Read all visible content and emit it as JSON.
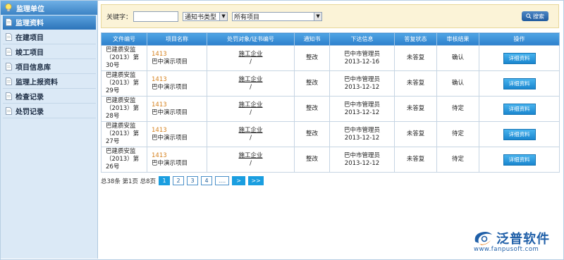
{
  "sidebar": {
    "title": "监理单位",
    "items": [
      {
        "label": "监理资料",
        "active": true
      },
      {
        "label": "在建项目",
        "active": false
      },
      {
        "label": "竣工项目",
        "active": false
      },
      {
        "label": "项目信息库",
        "active": false
      },
      {
        "label": "监理上报资料",
        "active": false
      },
      {
        "label": "检查记录",
        "active": false
      },
      {
        "label": "处罚记录",
        "active": false
      }
    ]
  },
  "search": {
    "keyword_label": "关键字：",
    "keyword_value": "",
    "type_select": "通知书类型",
    "project_select": "所有项目",
    "button_label": "搜索"
  },
  "table": {
    "headers": [
      "文件编号",
      "项目名称",
      "处罚对象/证书编号",
      "通知书",
      "下达信息",
      "答复状态",
      "审核结果",
      "操作"
    ],
    "rows": [
      {
        "doc_no": "巴建质安监（2013）第30号",
        "project_code": "1413",
        "project_name": "巴中演示项目",
        "target": "施工企业",
        "target_sub": "/",
        "notice": "整改",
        "issuer": "巴中市管理员",
        "date": "2013-12-16",
        "reply": "未答复",
        "result": "确认",
        "action": "详细资料"
      },
      {
        "doc_no": "巴建质安监（2013）第29号",
        "project_code": "1413",
        "project_name": "巴中演示项目",
        "target": "施工企业",
        "target_sub": "/",
        "notice": "整改",
        "issuer": "巴中市管理员",
        "date": "2013-12-12",
        "reply": "未答复",
        "result": "确认",
        "action": "详细资料"
      },
      {
        "doc_no": "巴建质安监（2013）第28号",
        "project_code": "1413",
        "project_name": "巴中演示项目",
        "target": "施工企业",
        "target_sub": "/",
        "notice": "整改",
        "issuer": "巴中市管理员",
        "date": "2013-12-12",
        "reply": "未答复",
        "result": "待定",
        "action": "详细资料"
      },
      {
        "doc_no": "巴建质安监（2013）第27号",
        "project_code": "1413",
        "project_name": "巴中演示项目",
        "target": "施工企业",
        "target_sub": "/",
        "notice": "整改",
        "issuer": "巴中市管理员",
        "date": "2013-12-12",
        "reply": "未答复",
        "result": "待定",
        "action": "详细资料"
      },
      {
        "doc_no": "巴建质安监（2013）第26号",
        "project_code": "1413",
        "project_name": "巴中演示项目",
        "target": "施工企业",
        "target_sub": "/",
        "notice": "整改",
        "issuer": "巴中市管理员",
        "date": "2013-12-12",
        "reply": "未答复",
        "result": "待定",
        "action": "详细资料"
      }
    ]
  },
  "pager": {
    "summary": "总38条 第1页 总8页",
    "pages": [
      "1",
      "2",
      "3",
      "4",
      "...."
    ],
    "next": ">",
    "last": ">>"
  },
  "logo": {
    "name": "泛普软件",
    "url": "www.fanpusoft.com",
    "color": "#1f5fa8"
  }
}
